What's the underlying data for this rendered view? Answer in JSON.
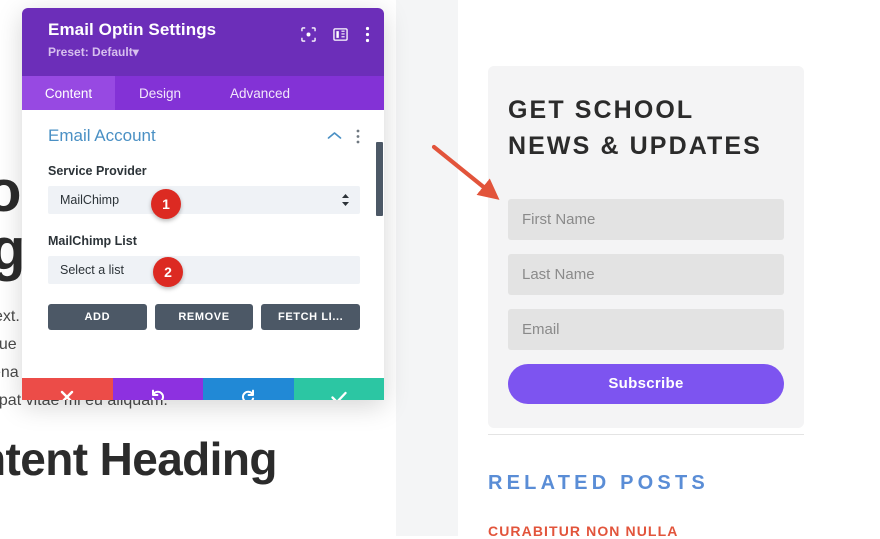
{
  "page_background": {
    "heading_fragment_1": "or",
    "heading_fragment_2": "g",
    "content_heading": "ntent Heading",
    "body_lines": [
      "ext.",
      "gue",
      "ena",
      "lutpat vitae mi eu aliquam."
    ]
  },
  "sidebar": {
    "optin": {
      "title": "GET SCHOOL NEWS & UPDATES",
      "fields": [
        {
          "name": "first-name",
          "placeholder": "First Name",
          "value": ""
        },
        {
          "name": "last-name",
          "placeholder": "Last Name",
          "value": ""
        },
        {
          "name": "email",
          "placeholder": "Email",
          "value": ""
        }
      ],
      "submit_label": "Subscribe",
      "accent_color": "#7d54f0",
      "background_color": "#f4f4f5"
    },
    "related": {
      "title": "RELATED POSTS",
      "title_color": "#5a8dd6",
      "first_post": "CURABITUR NON NULLA",
      "first_post_color": "#e2543b"
    }
  },
  "modal": {
    "title": "Email Optin Settings",
    "preset": "Preset: Default",
    "preset_caret": "▾",
    "header_color": "#6c2eb9",
    "header_icons": [
      {
        "name": "focus-icon",
        "label": "Focus"
      },
      {
        "name": "layout-icon",
        "label": "Layout"
      },
      {
        "name": "kebab-menu-icon",
        "label": "More options"
      }
    ],
    "tabs": [
      {
        "label": "Content",
        "active": true
      },
      {
        "label": "Design",
        "active": false
      },
      {
        "label": "Advanced",
        "active": false
      }
    ],
    "section": {
      "title": "Email Account",
      "collapse_icon": "chevron-up-icon",
      "kebab_icon": "kebab-menu-icon"
    },
    "fields": {
      "service_provider_label": "Service Provider",
      "service_provider_value": "MailChimp",
      "list_label": "MailChimp List",
      "list_value": "Select a list"
    },
    "stacked_buttons": [
      {
        "label": "ADD",
        "name": "add-button"
      },
      {
        "label": "REMOVE",
        "name": "remove-button"
      },
      {
        "label": "FETCH LI...",
        "name": "fetch-lists-button"
      }
    ],
    "actions": [
      {
        "name": "cancel-button",
        "icon": "close-icon",
        "color": "#ec4c48"
      },
      {
        "name": "undo-button",
        "icon": "undo-icon",
        "color": "#8d31e0"
      },
      {
        "name": "redo-button",
        "icon": "redo-icon",
        "color": "#2189d6"
      },
      {
        "name": "save-button",
        "icon": "check-icon",
        "color": "#2cc6a3"
      }
    ]
  },
  "annotations": {
    "badges": [
      {
        "number": "1",
        "target": "service-provider-select"
      },
      {
        "number": "2",
        "target": "mailchimp-list-select"
      }
    ],
    "arrow": {
      "name": "annotation-arrow",
      "color": "#e2543b"
    }
  }
}
